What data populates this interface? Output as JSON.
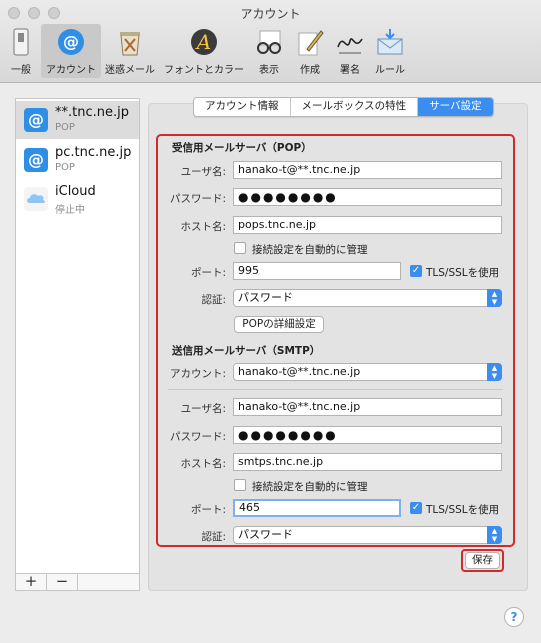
{
  "window": {
    "title": "アカウント"
  },
  "toolbar": {
    "items": [
      {
        "label": "一般",
        "icon": "general-switch-icon"
      },
      {
        "label": "アカウント",
        "icon": "at-sign-icon"
      },
      {
        "label": "迷惑メール",
        "icon": "junk-trash-icon"
      },
      {
        "label": "フォントとカラー",
        "icon": "fonts-colors-icon"
      },
      {
        "label": "表示",
        "icon": "glasses-icon"
      },
      {
        "label": "作成",
        "icon": "compose-pencil-icon"
      },
      {
        "label": "署名",
        "icon": "signature-icon"
      },
      {
        "label": "ルール",
        "icon": "rules-envelope-icon"
      }
    ],
    "selected": "アカウント"
  },
  "sidebar": {
    "accounts": [
      {
        "name": "**.tnc.ne.jp",
        "type": "POP",
        "icon": "at-sign-icon"
      },
      {
        "name": "pc.tnc.ne.jp",
        "type": "POP",
        "icon": "at-sign-icon"
      },
      {
        "name": "iCloud",
        "type": "停止中",
        "icon": "icloud-icon"
      }
    ],
    "add_label": "+",
    "remove_label": "−"
  },
  "tabs": [
    {
      "label": "アカウント情報",
      "active": false
    },
    {
      "label": "メールボックスの特性",
      "active": false
    },
    {
      "label": "サーバ設定",
      "active": true
    }
  ],
  "pop": {
    "section_title": "受信用メールサーバ（POP）",
    "username_label": "ユーザ名:",
    "username": "hanako-t@**.tnc.ne.jp",
    "password_label": "パスワード:",
    "password": "●●●●●●●●",
    "host_label": "ホスト名:",
    "host": "pops.tnc.ne.jp",
    "auto_manage_label": "接続設定を自動的に管理",
    "auto_manage": false,
    "port_label": "ポート:",
    "port": "995",
    "tls_label": "TLS/SSLを使用",
    "tls": true,
    "auth_label": "認証:",
    "auth": "パスワード",
    "advanced_button": "POPの詳細設定"
  },
  "smtp": {
    "section_title": "送信用メールサーバ（SMTP）",
    "account_label": "アカウント:",
    "account": "hanako-t@**.tnc.ne.jp",
    "username_label": "ユーザ名:",
    "username": "hanako-t@**.tnc.ne.jp",
    "password_label": "パスワード:",
    "password": "●●●●●●●●",
    "host_label": "ホスト名:",
    "host": "smtps.tnc.ne.jp",
    "auto_manage_label": "接続設定を自動的に管理",
    "auto_manage": false,
    "port_label": "ポート:",
    "port": "465",
    "tls_label": "TLS/SSLを使用",
    "tls": true,
    "auth_label": "認証:",
    "auth": "パスワード"
  },
  "save_button": "保存",
  "help_label": "?",
  "colors": {
    "accent": "#3b8df0",
    "highlight": "#d12a2a"
  }
}
